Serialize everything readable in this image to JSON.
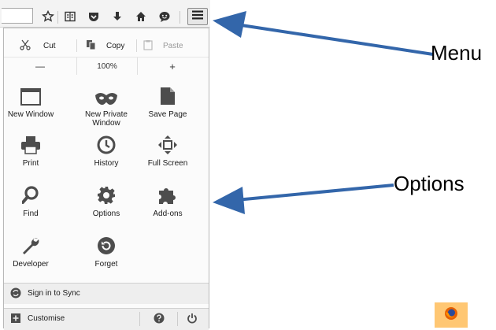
{
  "toolbar": {
    "icons": [
      "bookmark-star-icon",
      "reading-list-icon",
      "pocket-icon",
      "download-icon",
      "home-icon",
      "hello-icon",
      "hamburger-menu-icon"
    ]
  },
  "menu": {
    "edit": {
      "cut": "Cut",
      "copy": "Copy",
      "paste": "Paste"
    },
    "zoom": {
      "minus": "—",
      "level": "100%",
      "plus": "+"
    },
    "items": [
      {
        "label": "New Window",
        "icon": "new-window-icon"
      },
      {
        "label": "New Private Window",
        "icon": "private-mask-icon"
      },
      {
        "label": "Save Page",
        "icon": "save-page-icon"
      },
      {
        "label": "Print",
        "icon": "print-icon"
      },
      {
        "label": "History",
        "icon": "history-clock-icon"
      },
      {
        "label": "Full Screen",
        "icon": "full-screen-icon"
      },
      {
        "label": "Find",
        "icon": "find-magnifier-icon"
      },
      {
        "label": "Options",
        "icon": "options-gear-icon"
      },
      {
        "label": "Add-ons",
        "icon": "addons-puzzle-icon"
      },
      {
        "label": "Developer",
        "icon": "developer-wrench-icon"
      },
      {
        "label": "Forget",
        "icon": "forget-icon"
      }
    ],
    "sync": "Sign in to Sync",
    "customise": "Customise"
  },
  "annotations": {
    "menu": "Menu",
    "options": "Options"
  },
  "colors": {
    "arrow": "#3366aa",
    "icon_gray": "#4d4d4d",
    "taskbar_highlight": "#ffc773"
  }
}
